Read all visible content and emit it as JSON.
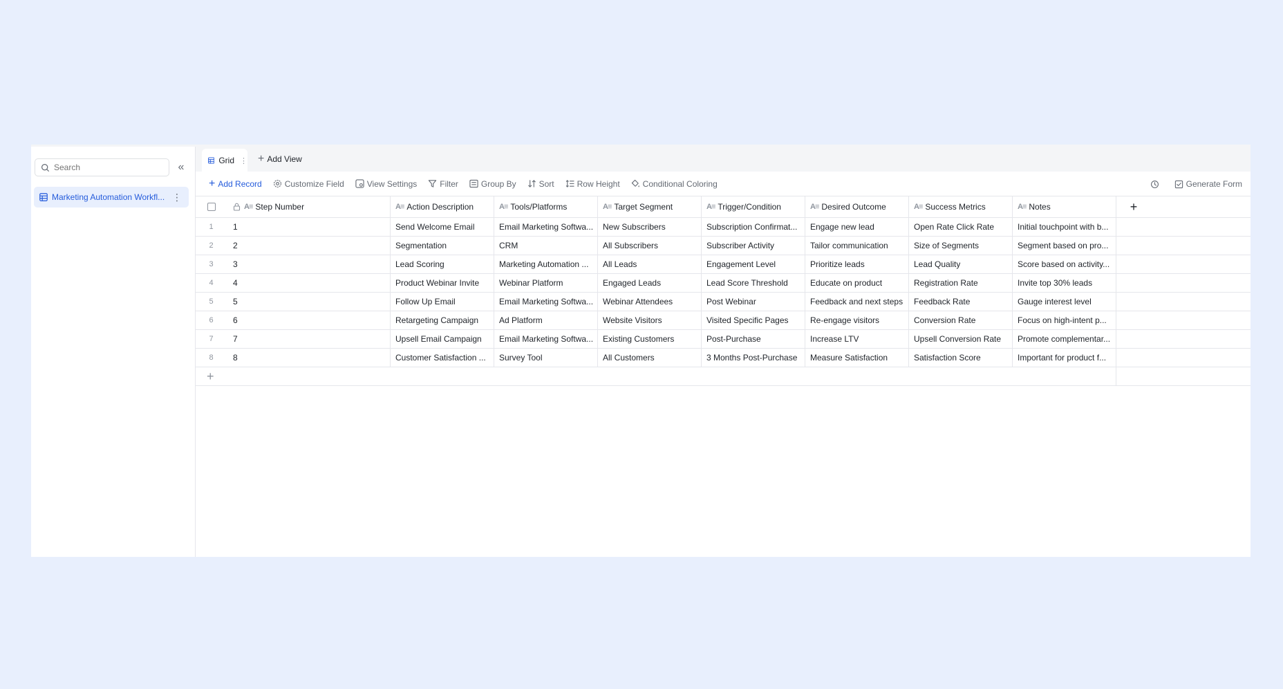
{
  "sidebar": {
    "search_placeholder": "Search",
    "tables": [
      {
        "label": "Marketing Automation Workfl..."
      }
    ]
  },
  "tabs": {
    "grid_label": "Grid",
    "add_view_label": "Add View"
  },
  "toolbar": {
    "add_record": "Add Record",
    "customize_field": "Customize Field",
    "view_settings": "View Settings",
    "filter": "Filter",
    "group_by": "Group By",
    "sort": "Sort",
    "row_height": "Row Height",
    "conditional_coloring": "Conditional Coloring",
    "generate_form": "Generate Form"
  },
  "columns": [
    "Step Number",
    "Action Description",
    "Tools/Platforms",
    "Target Segment",
    "Trigger/Condition",
    "Desired Outcome",
    "Success Metrics",
    "Notes"
  ],
  "rows": [
    {
      "idx": "1",
      "cells": [
        "1",
        "Send Welcome Email",
        "Email Marketing Softwa...",
        "New Subscribers",
        "Subscription Confirmat...",
        "Engage new lead",
        "Open Rate Click Rate",
        "Initial touchpoint with b..."
      ]
    },
    {
      "idx": "2",
      "cells": [
        "2",
        "Segmentation",
        "CRM",
        "All Subscribers",
        "Subscriber Activity",
        "Tailor communication",
        "Size of Segments",
        "Segment based on pro..."
      ]
    },
    {
      "idx": "3",
      "cells": [
        "3",
        "Lead Scoring",
        "Marketing Automation ...",
        "All Leads",
        "Engagement Level",
        "Prioritize leads",
        "Lead Quality",
        "Score based on activity..."
      ]
    },
    {
      "idx": "4",
      "cells": [
        "4",
        "Product Webinar Invite",
        "Webinar Platform",
        "Engaged Leads",
        "Lead Score Threshold",
        "Educate on product",
        "Registration Rate",
        "Invite top 30% leads"
      ]
    },
    {
      "idx": "5",
      "cells": [
        "5",
        "Follow Up Email",
        "Email Marketing Softwa...",
        "Webinar Attendees",
        "Post Webinar",
        "Feedback and next steps",
        "Feedback Rate",
        "Gauge interest level"
      ]
    },
    {
      "idx": "6",
      "cells": [
        "6",
        "Retargeting Campaign",
        "Ad Platform",
        "Website Visitors",
        "Visited Specific Pages",
        "Re-engage visitors",
        "Conversion Rate",
        "Focus on high-intent p..."
      ]
    },
    {
      "idx": "7",
      "cells": [
        "7",
        "Upsell Email Campaign",
        "Email Marketing Softwa...",
        "Existing Customers",
        "Post-Purchase",
        "Increase LTV",
        "Upsell Conversion Rate",
        "Promote complementar..."
      ]
    },
    {
      "idx": "8",
      "cells": [
        "8",
        "Customer Satisfaction ...",
        "Survey Tool",
        "All Customers",
        "3 Months Post-Purchase",
        "Measure Satisfaction",
        "Satisfaction Score",
        "Important for product f..."
      ]
    }
  ],
  "colors": {
    "accent": "#245bdb",
    "background": "#e8effd",
    "border": "#e5e6eb"
  }
}
